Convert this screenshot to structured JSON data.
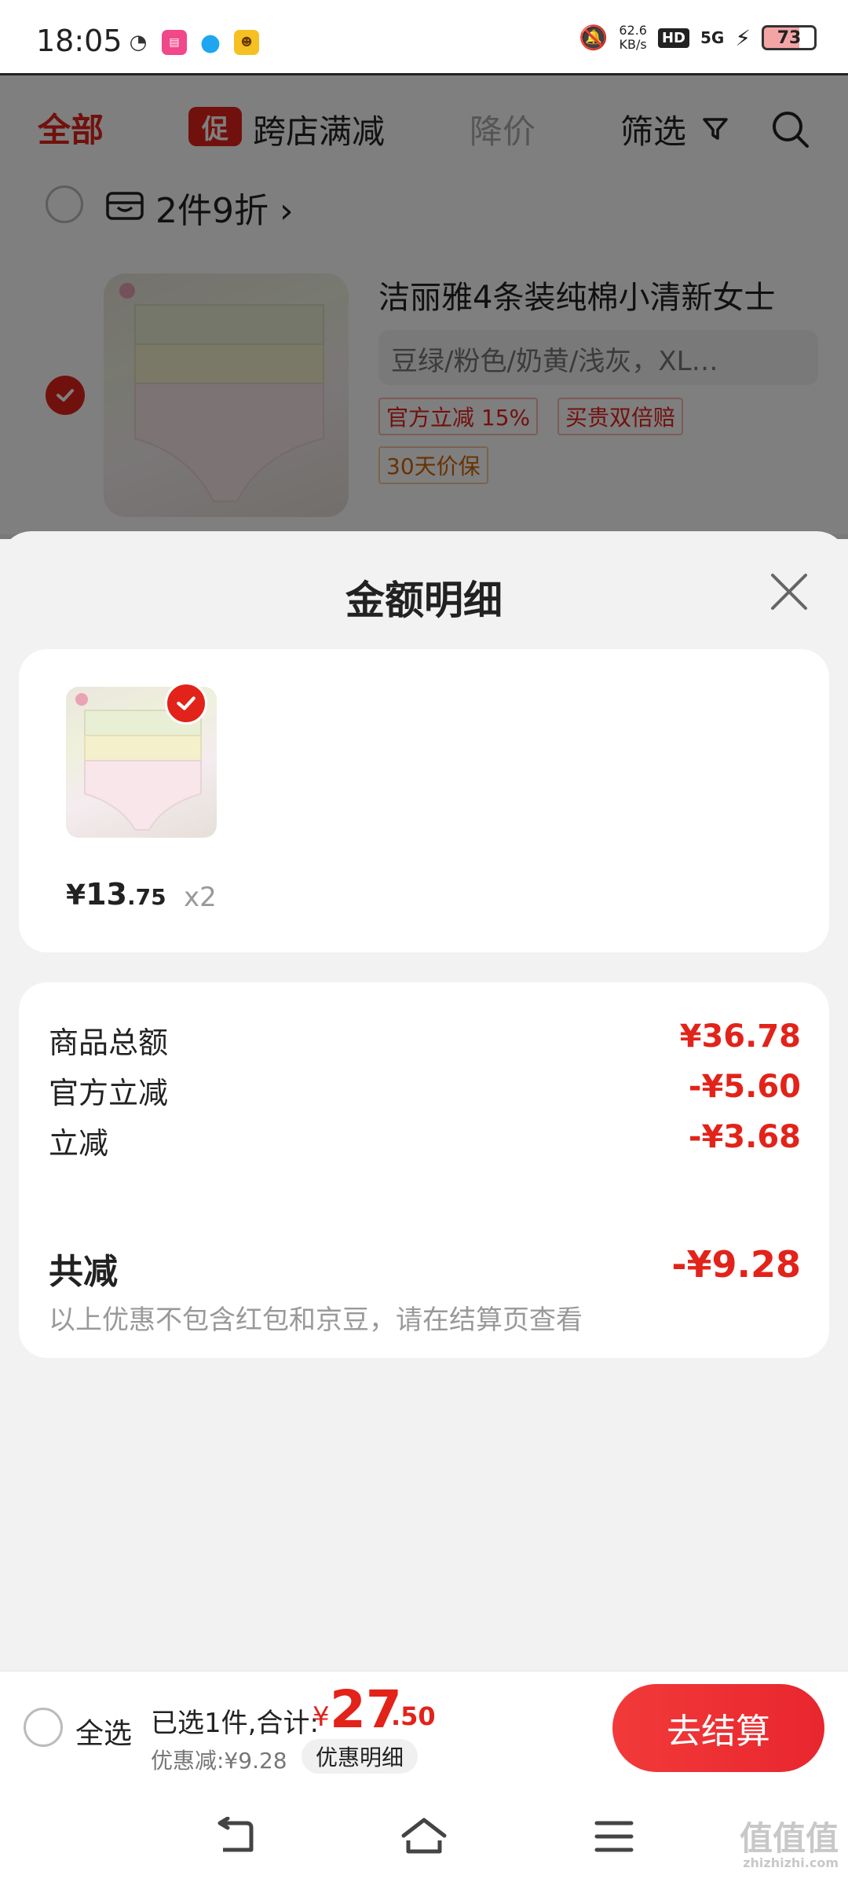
{
  "status_bar": {
    "time": "18:05",
    "net_speed_value": "62.6",
    "net_speed_unit": "KB/s",
    "hd_label": "HD",
    "signal_label": "5G",
    "battery": "73"
  },
  "filter_bar": {
    "all": "全部",
    "promo_badge": "促",
    "promo": "跨店满减",
    "price_drop": "降价",
    "filter": "筛选"
  },
  "shop": {
    "promo_title": "2件9折 ›"
  },
  "cart_item": {
    "title": "洁丽雅4条装纯棉小清新女士",
    "spec": "豆绿/粉色/奶黄/浅灰，XL…",
    "tags": [
      "官方立减 15%",
      "买贵双倍赔",
      "30天价保"
    ]
  },
  "sheet": {
    "title": "金额明细",
    "goods": {
      "currency": "¥",
      "price_int": "13",
      "price_dec": ".75",
      "qty": "x2"
    },
    "details": [
      {
        "label": "商品总额",
        "value": "¥36.78"
      },
      {
        "label": "官方立减",
        "value": "-¥5.60"
      },
      {
        "label": "立减",
        "value": "-¥3.68"
      }
    ],
    "total_label": "共减",
    "total_value": "-¥9.28",
    "note": "以上优惠不包含红包和京豆，请在结算页查看"
  },
  "checkout": {
    "select_all": "全选",
    "selected_text": "已选1件,合计:",
    "currency": "¥",
    "sum_int": "27",
    "sum_dec": ".50",
    "discount_text": "优惠减:¥9.28",
    "discount_detail": "优惠明细",
    "checkout_button": "去结算"
  },
  "watermark": {
    "main": "值值值",
    "sub": "zhizhizhi.com"
  },
  "colors": {
    "accent": "#e2231a",
    "sheet_bg": "#f2f2f2",
    "card_bg": "#ffffff"
  }
}
